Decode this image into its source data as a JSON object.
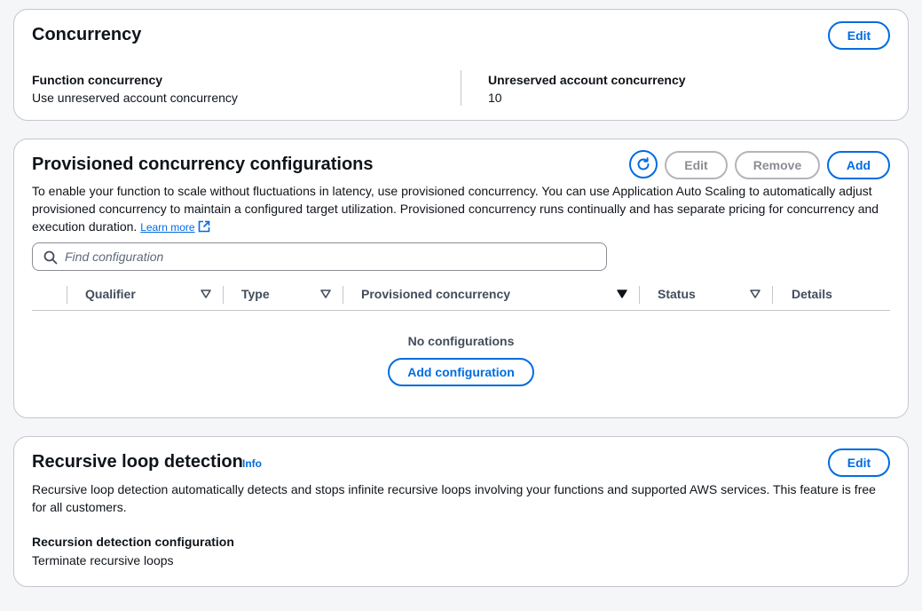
{
  "concurrency": {
    "title": "Concurrency",
    "edit_label": "Edit",
    "function_concurrency_label": "Function concurrency",
    "function_concurrency_value": "Use unreserved account concurrency",
    "unreserved_label": "Unreserved account concurrency",
    "unreserved_value": "10"
  },
  "provisioned": {
    "title": "Provisioned concurrency configurations",
    "edit_label": "Edit",
    "remove_label": "Remove",
    "add_label": "Add",
    "description": "To enable your function to scale without fluctuations in latency, use provisioned concurrency. You can use Application Auto Scaling to automatically adjust provisioned concurrency to maintain a configured target utilization. Provisioned concurrency runs continually and has separate pricing for concurrency and execution duration.",
    "learn_more": "Learn more",
    "search_placeholder": "Find configuration",
    "columns": [
      "Qualifier",
      "Type",
      "Provisioned concurrency",
      "Status",
      "Details"
    ],
    "empty_text": "No configurations",
    "add_configuration_label": "Add configuration"
  },
  "recursive": {
    "title": "Recursive loop detection",
    "info_label": "Info",
    "edit_label": "Edit",
    "description": "Recursive loop detection automatically detects and stops infinite recursive loops involving your functions and supported AWS services. This feature is free for all customers.",
    "config_label": "Recursion detection configuration",
    "config_value": "Terminate recursive loops"
  },
  "colors": {
    "accent": "#006ce0",
    "disabled": "#8c8c94",
    "border": "#c6c6cd"
  }
}
